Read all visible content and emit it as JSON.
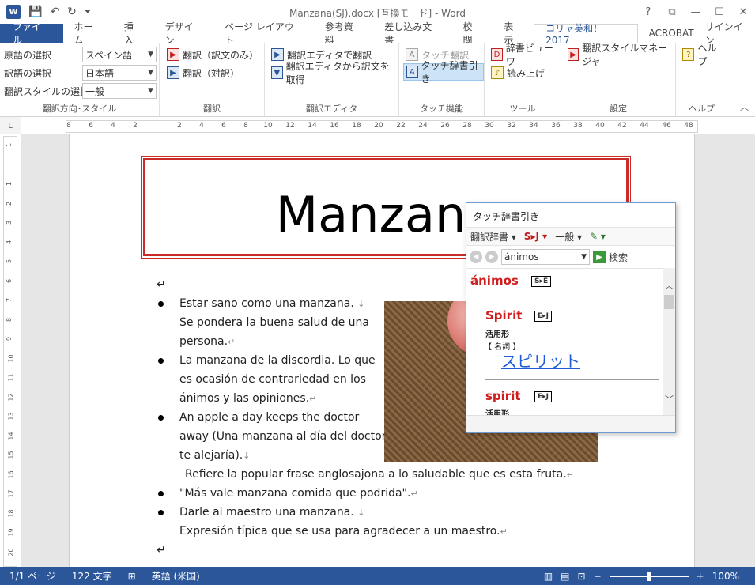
{
  "app": {
    "title": "Manzana(SJ).docx [互換モード] - Word",
    "word_icon": "W",
    "signin": "サインイン"
  },
  "qat": {
    "save": "💾",
    "undo": "↶",
    "redo": "↻",
    "more": "⏷"
  },
  "window_controls": [
    "?",
    "⧉",
    "—",
    "☐",
    "✕"
  ],
  "tabs": [
    "ファイル",
    "ホーム",
    "挿入",
    "デザイン",
    "ページ レイアウト",
    "参考資料",
    "差し込み文書",
    "校閲",
    "表示",
    "コリャ英和！2017",
    "ACROBAT"
  ],
  "ribbon": {
    "direction_group": {
      "label": "翻訳方向･スタイル",
      "source_label": "原語の選択",
      "source_value": "スペイン語",
      "target_label": "訳語の選択",
      "target_value": "日本語",
      "style_label": "翻訳スタイルの選択",
      "style_value": "一般"
    },
    "translate_group": {
      "label": "翻訳",
      "btn_original": "翻訳（訳文のみ）",
      "btn_parallel": "翻訳（対訳）"
    },
    "editor_group": {
      "label": "翻訳エディタ",
      "btn_translate": "翻訳エディタで翻訳",
      "btn_get": "翻訳エディタから訳文を取得"
    },
    "touch_group": {
      "label": "タッチ機能",
      "btn_touch_translate": "タッチ翻訳",
      "btn_touch_dict": "タッチ辞書引き"
    },
    "tools_group": {
      "label": "ツール",
      "btn_viewer": "辞書ビューワ",
      "btn_read": "読み上げ"
    },
    "settings_group": {
      "label": "設定",
      "btn_style_manager": "翻訳スタイルマネージャ"
    },
    "help_group": {
      "label": "ヘルプ",
      "btn_help": "ヘルプ"
    }
  },
  "ruler": {
    "h_ticks": [
      "8",
      "6",
      "4",
      "2",
      "",
      "2",
      "4",
      "6",
      "8",
      "10",
      "12",
      "14",
      "16",
      "18",
      "20",
      "22",
      "24",
      "26",
      "28",
      "30",
      "32",
      "34",
      "36",
      "38",
      "40",
      "42",
      "44",
      "46",
      "48"
    ],
    "v_ticks": [
      "1",
      "",
      "1",
      "2",
      "3",
      "4",
      "5",
      "6",
      "7",
      "8",
      "9",
      "10",
      "11",
      "12",
      "13",
      "14",
      "15",
      "16",
      "17",
      "18",
      "19",
      "20"
    ],
    "corner": "L"
  },
  "document": {
    "heading": "Manzana",
    "lines": [
      "Estar sano como una manzana.",
      "Se pondera la buena salud de una",
      "persona.",
      "La manzana de la discordia. Lo que",
      "es ocasión de contrariedad en los",
      "ánimos y las opiniones.",
      "An apple a day keeps the doctor",
      "away (Una manzana al día del doctor",
      "te alejaría).",
      "Refiere la popular frase anglosajona a lo saludable que es esta fruta.",
      "\"Más vale manzana comida que podrida\".",
      "Darle al maestro una manzana.",
      "Expresión típica que se usa para agradecer a un maestro."
    ],
    "para_mark": "↵",
    "line_break": "↓"
  },
  "popup": {
    "title": "タッチ辞書引き",
    "toolbar": [
      "翻訳辞書 ▾",
      "S▸J ▾",
      "一般 ▾",
      "✎ ▾"
    ],
    "search_value": "ánimos",
    "search_button": "検索",
    "headword": "ánimos",
    "headword_tag": "S▸E",
    "entries": [
      {
        "word": "Spirit",
        "tag": "E▸J",
        "form": "活用形",
        "pos": "【 名詞 】",
        "translation": "スピリット"
      },
      {
        "word": "spirit",
        "tag": "E▸J",
        "form": "活用形"
      }
    ]
  },
  "statusbar": {
    "page": "1/1 ページ",
    "words": "122 文字",
    "lang": "英語 (米国)",
    "zoom": "100%",
    "zoom_minus": "−",
    "zoom_plus": "+"
  }
}
